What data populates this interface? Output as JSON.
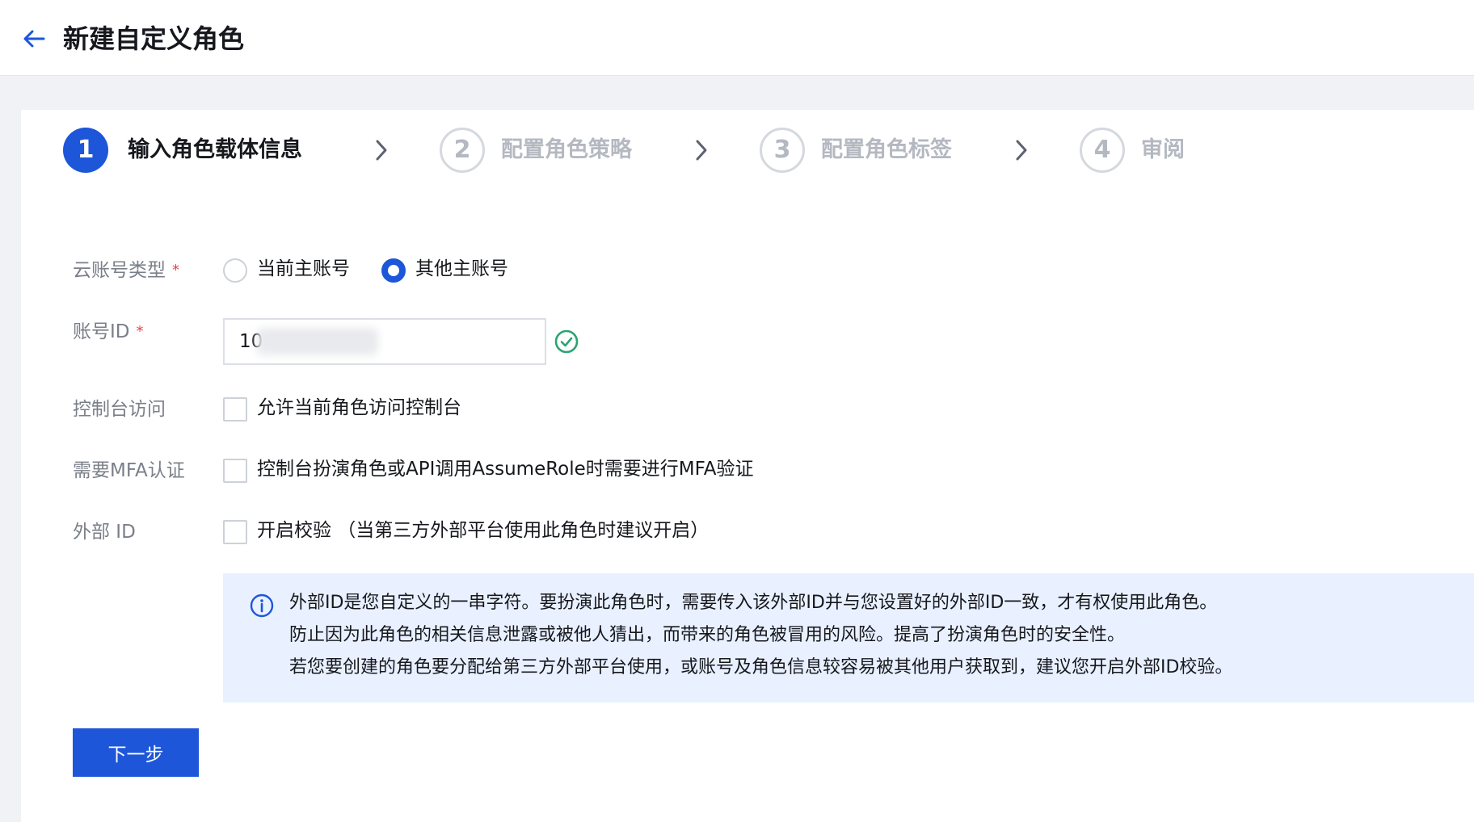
{
  "header": {
    "back_icon": "arrow-left-icon",
    "title": "新建自定义角色"
  },
  "steps": [
    {
      "number": "1",
      "label": "输入角色载体信息",
      "state": "active"
    },
    {
      "number": "2",
      "label": "配置角色策略",
      "state": "inactive"
    },
    {
      "number": "3",
      "label": "配置角色标签",
      "state": "inactive"
    },
    {
      "number": "4",
      "label": "审阅",
      "state": "inactive"
    }
  ],
  "form": {
    "account_type": {
      "label": "云账号类型",
      "required_mark": "*",
      "options": [
        {
          "label": "当前主账号",
          "checked": false
        },
        {
          "label": "其他主账号",
          "checked": true
        }
      ]
    },
    "account_id": {
      "label": "账号ID",
      "required_mark": "*",
      "value": "10",
      "status_icon": "check-circle-icon"
    },
    "console_access": {
      "label": "控制台访问",
      "checkbox_label": "允许当前角色访问控制台",
      "checked": false
    },
    "mfa": {
      "label": "需要MFA认证",
      "checkbox_label": "控制台扮演角色或API调用AssumeRole时需要进行MFA验证",
      "checked": false
    },
    "external_id": {
      "label": "外部 ID",
      "checkbox_label": "开启校验 （当第三方外部平台使用此角色时建议开启）",
      "checked": false
    }
  },
  "info": {
    "icon": "info-circle-icon",
    "lines": [
      "外部ID是您自定义的一串字符。要扮演此角色时，需要传入该外部ID并与您设置好的外部ID一致，才有权使用此角色。",
      "防止因为此角色的相关信息泄露或被他人猜出，而带来的角色被冒用的风险。提高了扮演角色时的安全性。",
      "若您要创建的角色要分配给第三方外部平台使用，或账号及角色信息较容易被其他用户获取到，建议您开启外部ID校验。"
    ]
  },
  "actions": {
    "next_label": "下一步"
  },
  "colors": {
    "primary": "#1d56d9",
    "required": "#e54545",
    "success": "#2ba471",
    "info_bg": "#e9f0ff"
  }
}
